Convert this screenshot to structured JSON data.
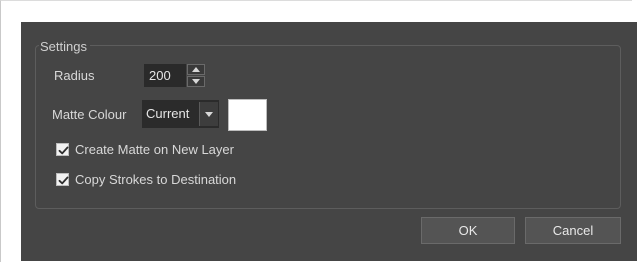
{
  "settings": {
    "group_title": "Settings",
    "radius_label": "Radius",
    "radius_value": "200",
    "matte_colour_label": "Matte Colour",
    "matte_colour_option": "Current",
    "matte_colour_swatch": "#ffffff",
    "create_matte_label": "Create Matte on New Layer",
    "create_matte_checked": true,
    "copy_strokes_label": "Copy Strokes to Destination",
    "copy_strokes_checked": true
  },
  "buttons": {
    "ok_label": "OK",
    "cancel_label": "Cancel"
  },
  "icons": {
    "spin_up": "chevron-up-icon",
    "spin_down": "chevron-down-icon",
    "dropdown": "chevron-down-icon",
    "checkbox": "checkmark-icon"
  }
}
